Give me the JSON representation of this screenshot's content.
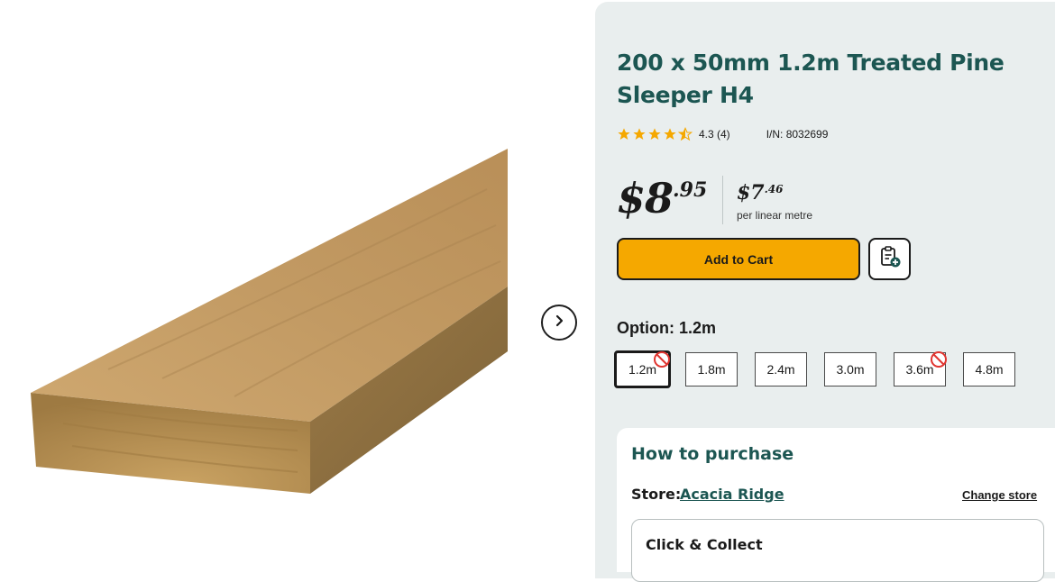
{
  "product": {
    "title": "200 x 50mm 1.2m Treated Pine Sleeper H4",
    "rating_text": "4.3 (4)",
    "item_number": "I/N: 8032699"
  },
  "price": {
    "dollars": "$8",
    "cents": ".95",
    "unit_dollars": "$7",
    "unit_cents": ".46",
    "unit_label": "per linear metre"
  },
  "actions": {
    "add_to_cart": "Add to Cart"
  },
  "options": {
    "label": "Option: 1.2m",
    "items": [
      {
        "label": "1.2m",
        "selected": true,
        "unavailable": true
      },
      {
        "label": "1.8m",
        "selected": false,
        "unavailable": false
      },
      {
        "label": "2.4m",
        "selected": false,
        "unavailable": false
      },
      {
        "label": "3.0m",
        "selected": false,
        "unavailable": false
      },
      {
        "label": "3.6m",
        "selected": false,
        "unavailable": true
      },
      {
        "label": "4.8m",
        "selected": false,
        "unavailable": false
      }
    ]
  },
  "purchase": {
    "title": "How to purchase",
    "store_label": "Store:",
    "store_name": "Acacia Ridge",
    "change_store": "Change store",
    "collect_title": "Click & Collect"
  },
  "colors": {
    "accent": "#1c5652",
    "cart_button": "#f5a800",
    "star": "#f5a800",
    "unavailable": "#e0342f",
    "panel_bg": "#e9eeee"
  },
  "icons": {
    "next": "chevron-right-icon",
    "list": "add-to-list-icon",
    "star": "star-icon",
    "unavailable": "no-entry-icon"
  }
}
